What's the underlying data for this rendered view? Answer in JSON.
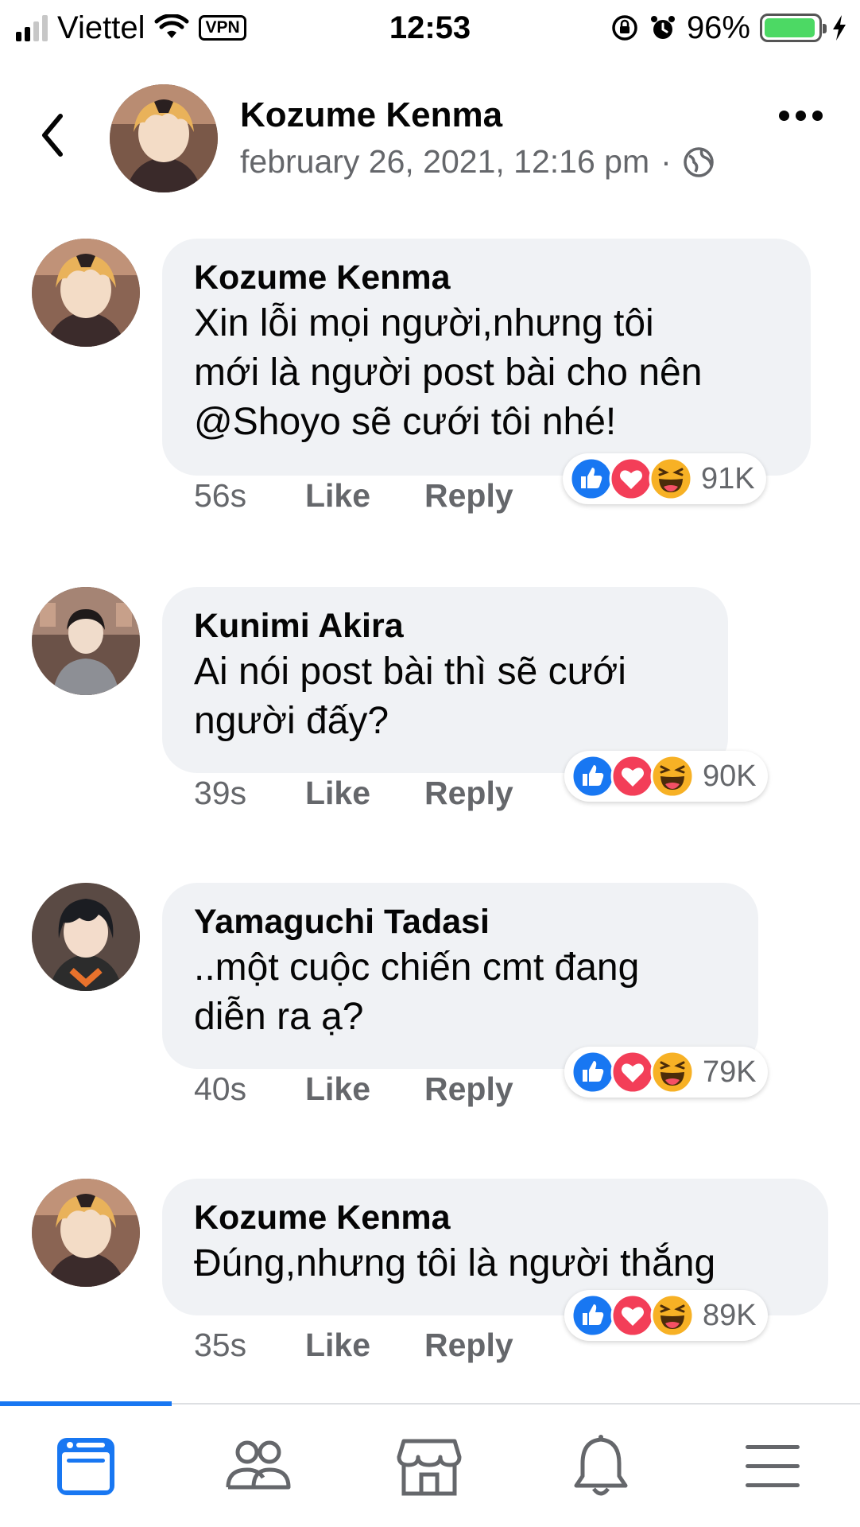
{
  "status_bar": {
    "carrier": "Viettel",
    "vpn_label": "VPN",
    "time": "12:53",
    "battery_percent": "96%",
    "battery_level": 0.96
  },
  "post_header": {
    "author": "Kozume Kenma",
    "timestamp": "february 26, 2021, 12:16 pm",
    "separator": "·",
    "privacy_icon": "globe-icon"
  },
  "comments": [
    {
      "author": "Kozume Kenma",
      "text": "Xin lỗi mọi người,nhưng tôi\nmới là người post bài cho nên\n@Shoyo sẽ cưới tôi nhé!",
      "time": "56s",
      "like_label": "Like",
      "reply_label": "Reply",
      "reaction_count": "91K"
    },
    {
      "author": "Kunimi Akira",
      "text": "Ai nói post bài thì sẽ cưới\nngười đấy?",
      "time": "39s",
      "like_label": "Like",
      "reply_label": "Reply",
      "reaction_count": "90K"
    },
    {
      "author": "Yamaguchi Tadasi",
      "text": "..một cuộc chiến cmt đang\ndiễn ra ạ?",
      "time": "40s",
      "like_label": "Like",
      "reply_label": "Reply",
      "reaction_count": "79K"
    },
    {
      "author": "Kozume Kenma",
      "text": "Đúng,nhưng tôi là người thắng",
      "time": "35s",
      "like_label": "Like",
      "reply_label": "Reply",
      "reaction_count": "89K"
    }
  ],
  "reaction_icons": [
    "like-icon",
    "love-icon",
    "haha-icon"
  ],
  "bottom_nav": {
    "items": [
      "news-feed-icon",
      "friends-icon",
      "marketplace-icon",
      "notifications-icon",
      "menu-icon"
    ],
    "active_index": 0
  },
  "colors": {
    "accent": "#1877f2",
    "bubble": "#f0f2f5",
    "secondary_text": "#65676b",
    "love": "#f33e58",
    "haha": "#f7b125"
  }
}
